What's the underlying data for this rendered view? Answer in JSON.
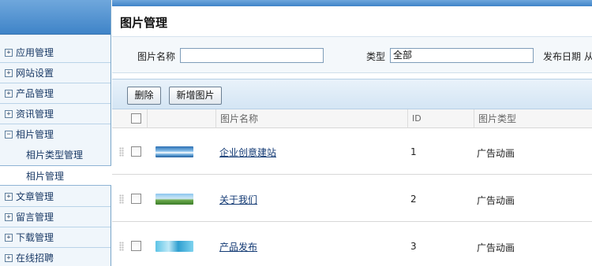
{
  "sidebar": {
    "items": [
      {
        "label": "应用管理",
        "expander": "+"
      },
      {
        "label": "网站设置",
        "expander": "+"
      },
      {
        "label": "产品管理",
        "expander": "+"
      },
      {
        "label": "资讯管理",
        "expander": "+"
      },
      {
        "label": "相片管理",
        "expander": "−"
      },
      {
        "label": "文章管理",
        "expander": "+"
      },
      {
        "label": "留言管理",
        "expander": "+"
      },
      {
        "label": "下载管理",
        "expander": "+"
      },
      {
        "label": "在线招聘",
        "expander": "+"
      }
    ],
    "subitems": [
      {
        "label": "相片类型管理"
      },
      {
        "label": "相片管理"
      }
    ]
  },
  "main": {
    "title": "图片管理",
    "search": {
      "name_label": "图片名称",
      "name_value": "",
      "type_label": "类型",
      "type_value": "全部",
      "date_label": "发布日期 从"
    },
    "toolbar": {
      "delete_label": "删除",
      "add_label": "新增图片"
    },
    "table": {
      "columns": [
        "图片名称",
        "ID",
        "图片类型"
      ],
      "rows": [
        {
          "name": "企业创意建站",
          "id": "1",
          "type": "广告动画",
          "thumb": "sky"
        },
        {
          "name": "关于我们",
          "id": "2",
          "type": "广告动画",
          "thumb": "field"
        },
        {
          "name": "产品发布",
          "id": "3",
          "type": "广告动画",
          "thumb": "sea"
        }
      ]
    }
  },
  "colors": {
    "header_blue": "#3f84c8",
    "sidebar_bg": "#f0f6fb",
    "link": "#133a74"
  }
}
